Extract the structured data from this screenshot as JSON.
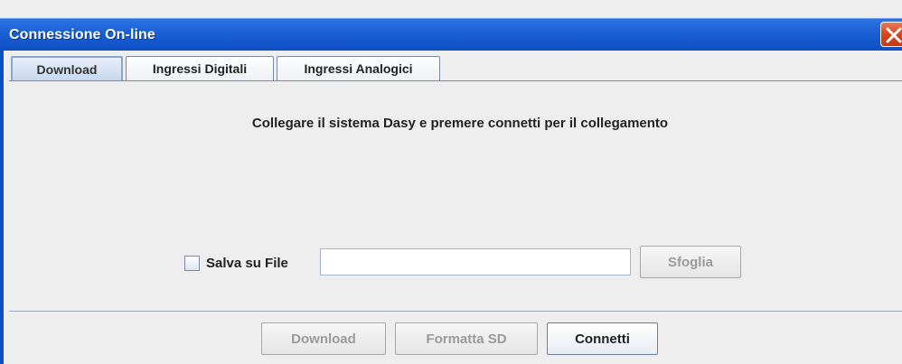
{
  "window": {
    "title": "Connessione On-line",
    "close_icon": "close-icon"
  },
  "tabs": [
    {
      "label": "Download",
      "selected": true
    },
    {
      "label": "Ingressi Digitali",
      "selected": false
    },
    {
      "label": "Ingressi Analogici",
      "selected": false
    }
  ],
  "content": {
    "instruction": "Collegare il sistema Dasy e premere connetti per il collegamento",
    "save_to_file": {
      "label": "Salva su File",
      "checked": false,
      "file_path_value": "",
      "browse_label": "Sfoglia",
      "browse_enabled": false
    }
  },
  "buttons": {
    "download": {
      "label": "Download",
      "enabled": false
    },
    "format_sd": {
      "label": "Formatta SD",
      "enabled": false
    },
    "connect": {
      "label": "Connetti",
      "enabled": true
    }
  },
  "colors": {
    "titlebar": "#1a5fd4",
    "close_button": "#d9461e",
    "window_bg": "#eeeeee",
    "disabled_text": "#9a9a9a"
  }
}
